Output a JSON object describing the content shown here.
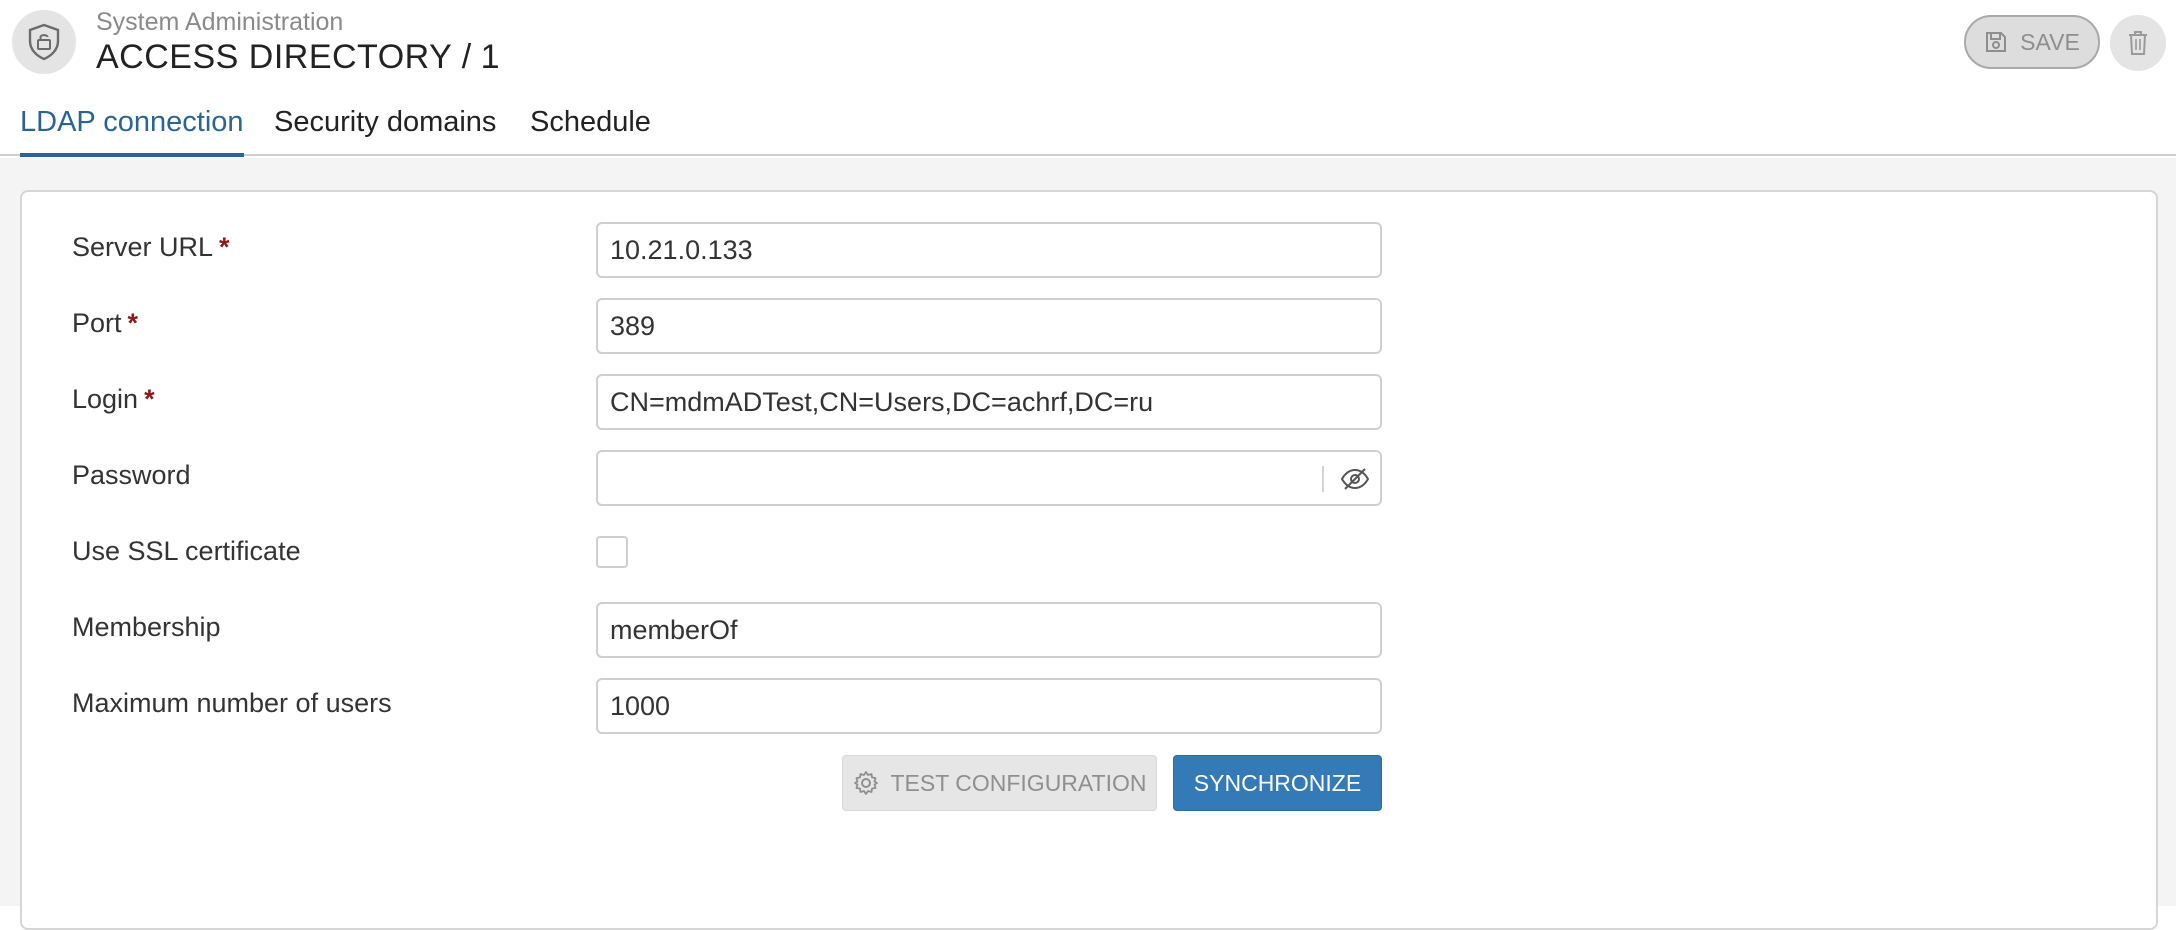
{
  "header": {
    "breadcrumb": "System Administration",
    "title": "ACCESS DIRECTORY",
    "title_separator": "/",
    "record_id": "1",
    "save_label": "SAVE",
    "icons": {
      "app": "shield-lock-icon",
      "save": "floppy-disk-icon",
      "delete": "trash-icon"
    }
  },
  "tabs": [
    {
      "label": "LDAP connection",
      "active": true
    },
    {
      "label": "Security domains",
      "active": false
    },
    {
      "label": "Schedule",
      "active": false
    }
  ],
  "form": {
    "server_url": {
      "label": "Server URL",
      "required_mark": "*",
      "value": "10.21.0.133"
    },
    "port": {
      "label": "Port",
      "required_mark": "*",
      "value": "389"
    },
    "login": {
      "label": "Login",
      "required_mark": "*",
      "value": "CN=mdmADTest,CN=Users,DC=achrf,DC=ru"
    },
    "password": {
      "label": "Password",
      "value": "",
      "toggle_icon": "eye-slash-icon"
    },
    "use_ssl": {
      "label": "Use SSL certificate",
      "checked": false
    },
    "membership": {
      "label": "Membership",
      "value": "memberOf"
    },
    "max_users": {
      "label": "Maximum number of users",
      "value": "1000"
    }
  },
  "actions": {
    "test_label": "TEST CONFIGURATION",
    "test_icon": "gear-icon",
    "sync_label": "SYNCHRONIZE"
  },
  "colors": {
    "accent": "#2a6496",
    "primary_button": "#337ab7",
    "required": "#8b1a1a"
  }
}
